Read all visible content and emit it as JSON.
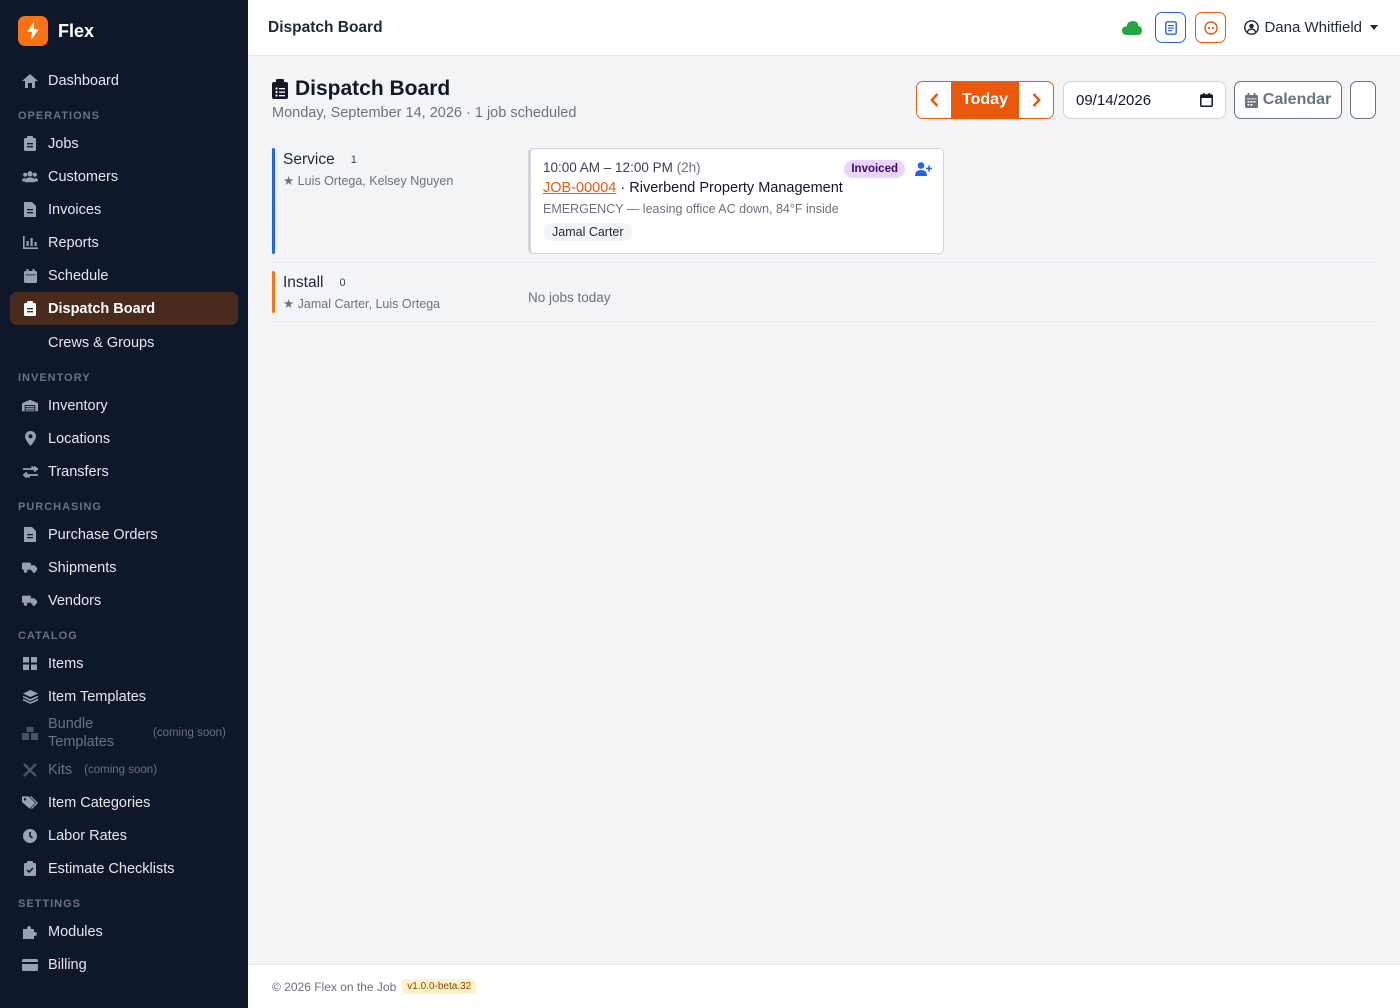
{
  "brand": {
    "name": "Flex",
    "accent": "#f97316"
  },
  "sidebar": {
    "dashboard": "Dashboard",
    "sections": {
      "operations": "OPERATIONS",
      "inventory": "INVENTORY",
      "purchasing": "PURCHASING",
      "catalog": "CATALOG",
      "settings": "SETTINGS"
    },
    "operations": [
      "Jobs",
      "Customers",
      "Invoices",
      "Reports",
      "Schedule",
      "Dispatch Board",
      "Crews & Groups"
    ],
    "inventory": [
      "Inventory",
      "Locations",
      "Transfers"
    ],
    "purchasing": [
      "Purchase Orders",
      "Shipments",
      "Vendors"
    ],
    "catalog": [
      "Items",
      "Item Templates",
      "Bundle Templates",
      "Kits",
      "Item Categories",
      "Labor Rates",
      "Estimate Checklists"
    ],
    "coming_soon": "(coming soon)",
    "settings": [
      "Modules",
      "Billing"
    ]
  },
  "topbar": {
    "title": "Dispatch Board",
    "user": "Dana Whitfield"
  },
  "page": {
    "title": "Dispatch Board",
    "subtitle": "Monday, September 14, 2026 · 1 job scheduled",
    "today_label": "Today",
    "date_value": "09/14/2026",
    "calendar_label": "Calendar"
  },
  "lanes": [
    {
      "name": "Service",
      "count": "1",
      "crew": "★ Luis Ortega, Kelsey Nguyen",
      "color": "#2563eb",
      "jobs": [
        {
          "time": "10:00 AM – 12:00 PM",
          "duration": "(2h)",
          "id": "JOB-00004",
          "separator": " · ",
          "customer": "Riverbend Property Management",
          "description": "EMERGENCY — leasing office AC down, 84°F inside",
          "tech": "Jamal Carter",
          "status": "Invoiced"
        }
      ]
    },
    {
      "name": "Install",
      "count": "0",
      "crew": "★ Jamal Carter, Luis Ortega",
      "color": "#f97316",
      "empty": "No jobs today"
    }
  ],
  "footer": {
    "copyright": "© 2026 Flex on the Job",
    "version": "v1.0.0-beta.32"
  }
}
